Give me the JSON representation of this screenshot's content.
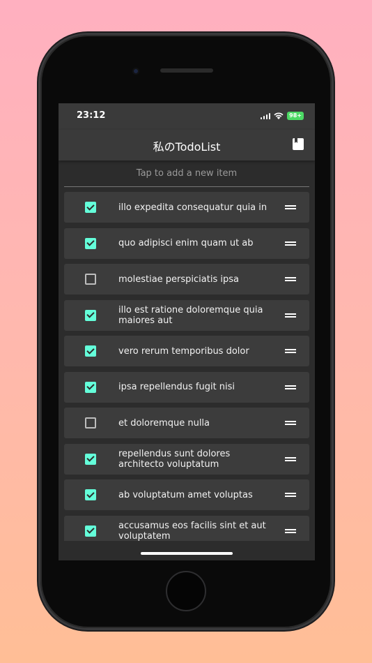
{
  "status": {
    "time": "23:12",
    "battery": "98+"
  },
  "app": {
    "title": "私のTodoList",
    "add_placeholder": "Tap to add a new item"
  },
  "colors": {
    "accent": "#64ffda",
    "background": "#2c2c2c",
    "bar": "#3a3a3a",
    "item": "#3c3c3c"
  },
  "icons": {
    "header_right": "bookmark-book-icon",
    "row_handle": "drag-handle-icon",
    "row_check": "checkbox-icon"
  },
  "todos": [
    {
      "text": "illo expedita consequatur quia in",
      "done": true
    },
    {
      "text": "quo adipisci enim quam ut ab",
      "done": true
    },
    {
      "text": "molestiae perspiciatis ipsa",
      "done": false
    },
    {
      "text": "illo est ratione doloremque quia maiores aut",
      "done": true
    },
    {
      "text": "vero rerum temporibus dolor",
      "done": true
    },
    {
      "text": "ipsa repellendus fugit nisi",
      "done": true
    },
    {
      "text": "et doloremque nulla",
      "done": false
    },
    {
      "text": "repellendus sunt dolores architecto voluptatum",
      "done": true
    },
    {
      "text": "ab voluptatum amet voluptas",
      "done": true
    },
    {
      "text": "accusamus eos facilis sint et aut voluptatem",
      "done": true
    }
  ]
}
